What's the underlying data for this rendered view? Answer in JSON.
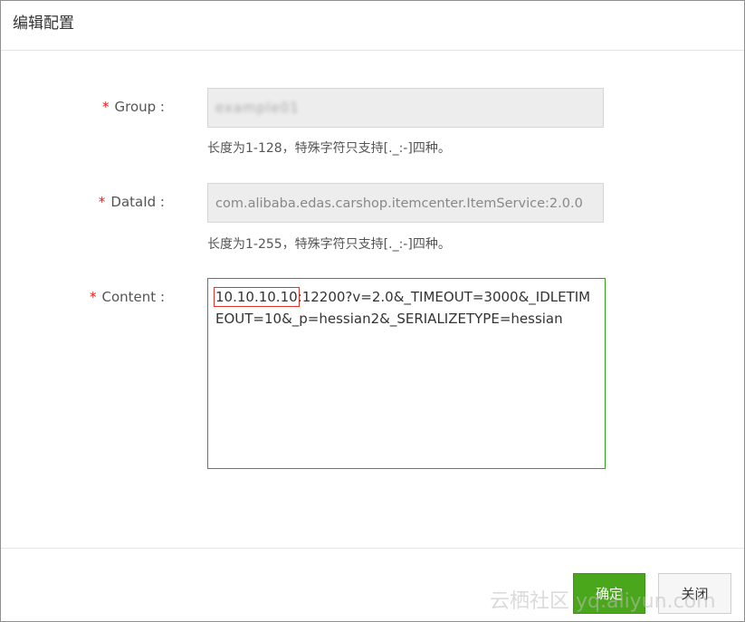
{
  "dialog": {
    "title": "编辑配置",
    "confirm_label": "确定",
    "close_label": "关闭"
  },
  "form": {
    "group": {
      "required_mark": "*",
      "label": "Group :",
      "value": "example01",
      "hint": "长度为1-128，特殊字符只支持[._:-]四种。"
    },
    "dataid": {
      "required_mark": "*",
      "label": "DataId :",
      "value": "com.alibaba.edas.carshop.itemcenter.ItemService:2.0.0",
      "hint": "长度为1-255，特殊字符只支持[._:-]四种。"
    },
    "content": {
      "required_mark": "*",
      "label": "Content :",
      "ip": "10.10.10.10",
      "rest": ":12200?v=2.0&_TIMEOUT=3000&_IDLETIMEOUT=10&_p=hessian2&_SERIALIZETYPE=hessian"
    }
  },
  "watermark": "云栖社区 yq.aliyun.com"
}
